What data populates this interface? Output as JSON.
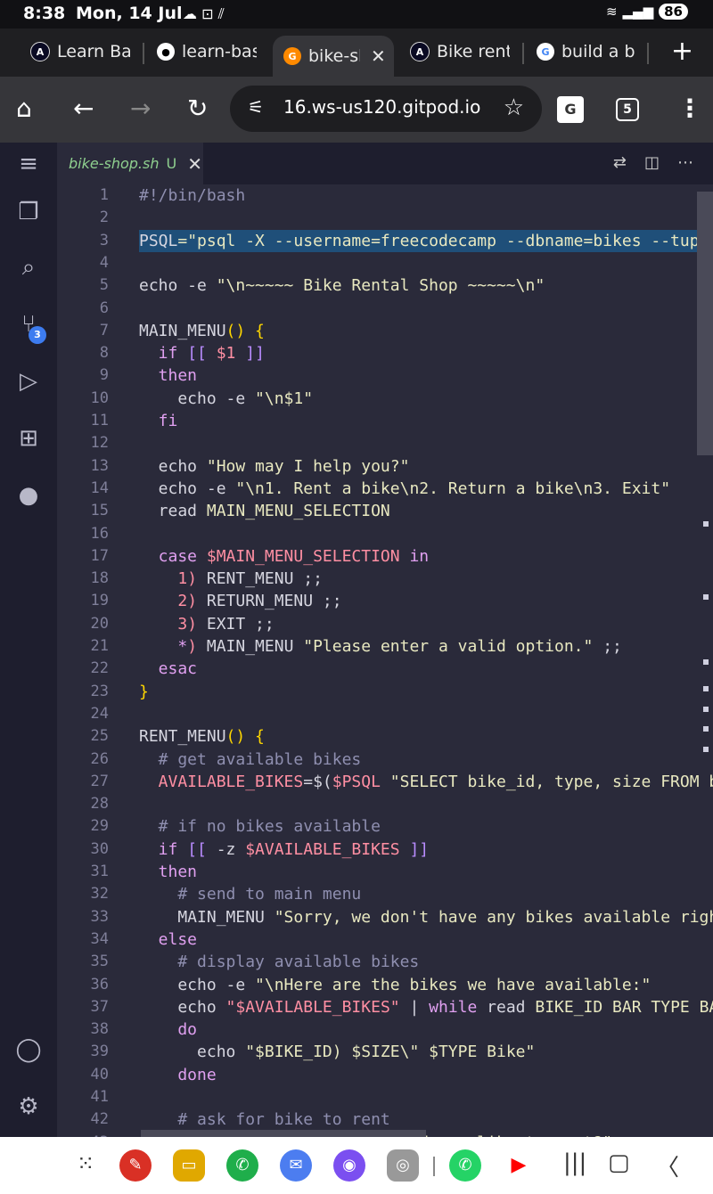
{
  "status_bar": {
    "time": "8:38",
    "date": "Mon, 14 Jul",
    "battery": "86"
  },
  "browser_tabs": [
    {
      "title": "Learn Bas",
      "favicon": "freecodecamp-icon"
    },
    {
      "title": "learn-bas",
      "favicon": "github-icon"
    },
    {
      "title": "bike-sh",
      "favicon": "gitpod-icon",
      "active": true
    },
    {
      "title": "Bike renta",
      "favicon": "freecodecamp-icon"
    },
    {
      "title": "build a bi",
      "favicon": "google-icon"
    }
  ],
  "toolbar": {
    "url": "16.ws-us120.gitpod.io",
    "tab_count": "5"
  },
  "editor_tab": {
    "filename": "bike-shop.sh",
    "status": "U"
  },
  "activity_badge": "3",
  "colors": {
    "keyword": "#e0a0f0",
    "variable": "#ff8fa3",
    "string": "#e8e8c0",
    "comment": "#8f8fb0",
    "brace": "#ffd700",
    "bracket": "#b98cff"
  },
  "code_lines": [
    {
      "n": "1",
      "segs": [
        {
          "t": "#!/bin/bash",
          "c": "comment"
        }
      ]
    },
    {
      "n": "2",
      "segs": []
    },
    {
      "n": "3",
      "segs": [
        {
          "t": "PSQL",
          "c": "plain"
        },
        {
          "t": "=\"psql -X --username=freecodecamp --dbname=bikes --tuples-only -c\"",
          "c": "string"
        }
      ],
      "highlight": true
    },
    {
      "n": "4",
      "segs": []
    },
    {
      "n": "5",
      "segs": [
        {
          "t": "echo -e ",
          "c": "plain"
        },
        {
          "t": "\"\\n~~~~~ Bike Rental Shop ~~~~~\\n\"",
          "c": "string"
        }
      ]
    },
    {
      "n": "6",
      "segs": []
    },
    {
      "n": "7",
      "segs": [
        {
          "t": "MAIN_MENU",
          "c": "plain"
        },
        {
          "t": "() {",
          "c": "brace"
        }
      ]
    },
    {
      "n": "8",
      "segs": [
        {
          "t": "  if ",
          "c": "keyword"
        },
        {
          "t": "[[ ",
          "c": "bracket"
        },
        {
          "t": "$1",
          "c": "variable"
        },
        {
          "t": " ]]",
          "c": "bracket"
        }
      ]
    },
    {
      "n": "9",
      "segs": [
        {
          "t": "  then",
          "c": "keyword"
        }
      ]
    },
    {
      "n": "10",
      "segs": [
        {
          "t": "    echo -e ",
          "c": "plain"
        },
        {
          "t": "\"\\n$1\"",
          "c": "string"
        }
      ]
    },
    {
      "n": "11",
      "segs": [
        {
          "t": "  fi",
          "c": "keyword"
        }
      ]
    },
    {
      "n": "12",
      "segs": []
    },
    {
      "n": "13",
      "segs": [
        {
          "t": "  echo ",
          "c": "plain"
        },
        {
          "t": "\"How may I help you?\"",
          "c": "string"
        }
      ]
    },
    {
      "n": "14",
      "segs": [
        {
          "t": "  echo -e ",
          "c": "plain"
        },
        {
          "t": "\"\\n1. Rent a bike\\n2. Return a bike\\n3. Exit\"",
          "c": "string"
        }
      ]
    },
    {
      "n": "15",
      "segs": [
        {
          "t": "  read ",
          "c": "plain"
        },
        {
          "t": "MAIN_MENU_SELECTION",
          "c": "string"
        }
      ]
    },
    {
      "n": "16",
      "segs": []
    },
    {
      "n": "17",
      "segs": [
        {
          "t": "  case ",
          "c": "keyword"
        },
        {
          "t": "$MAIN_MENU_SELECTION",
          "c": "variable"
        },
        {
          "t": " in",
          "c": "keyword"
        }
      ]
    },
    {
      "n": "18",
      "segs": [
        {
          "t": "    1",
          "c": "variable"
        },
        {
          "t": ") ",
          "c": "variable"
        },
        {
          "t": "RENT_MENU ;;",
          "c": "plain"
        }
      ]
    },
    {
      "n": "19",
      "segs": [
        {
          "t": "    2",
          "c": "variable"
        },
        {
          "t": ") ",
          "c": "variable"
        },
        {
          "t": "RETURN_MENU ;;",
          "c": "plain"
        }
      ]
    },
    {
      "n": "20",
      "segs": [
        {
          "t": "    3",
          "c": "variable"
        },
        {
          "t": ") ",
          "c": "variable"
        },
        {
          "t": "EXIT ;;",
          "c": "plain"
        }
      ]
    },
    {
      "n": "21",
      "segs": [
        {
          "t": "    *",
          "c": "keyword"
        },
        {
          "t": ") ",
          "c": "variable"
        },
        {
          "t": "MAIN_MENU ",
          "c": "plain"
        },
        {
          "t": "\"Please enter a valid option.\"",
          "c": "string"
        },
        {
          "t": " ;;",
          "c": "plain"
        }
      ]
    },
    {
      "n": "22",
      "segs": [
        {
          "t": "  esac",
          "c": "keyword"
        }
      ]
    },
    {
      "n": "23",
      "segs": [
        {
          "t": "}",
          "c": "brace"
        }
      ]
    },
    {
      "n": "24",
      "segs": []
    },
    {
      "n": "25",
      "segs": [
        {
          "t": "RENT_MENU",
          "c": "plain"
        },
        {
          "t": "() {",
          "c": "brace"
        }
      ]
    },
    {
      "n": "26",
      "segs": [
        {
          "t": "  # get available bikes",
          "c": "comment"
        }
      ]
    },
    {
      "n": "27",
      "segs": [
        {
          "t": "  AVAILABLE_BIKES",
          "c": "variable"
        },
        {
          "t": "=$(",
          "c": "plain"
        },
        {
          "t": "$PSQL",
          "c": "variable"
        },
        {
          "t": " \"SELECT bike_id, type, size FROM bikes WHERE available = true ORDER BY bike_id\")",
          "c": "string"
        }
      ]
    },
    {
      "n": "28",
      "segs": []
    },
    {
      "n": "29",
      "segs": [
        {
          "t": "  # if no bikes available",
          "c": "comment"
        }
      ]
    },
    {
      "n": "30",
      "segs": [
        {
          "t": "  if ",
          "c": "keyword"
        },
        {
          "t": "[[ ",
          "c": "bracket"
        },
        {
          "t": "-z ",
          "c": "plain"
        },
        {
          "t": "$AVAILABLE_BIKES",
          "c": "variable"
        },
        {
          "t": " ]]",
          "c": "bracket"
        }
      ]
    },
    {
      "n": "31",
      "segs": [
        {
          "t": "  then",
          "c": "keyword"
        }
      ]
    },
    {
      "n": "32",
      "segs": [
        {
          "t": "    # send to main menu",
          "c": "comment"
        }
      ]
    },
    {
      "n": "33",
      "segs": [
        {
          "t": "    MAIN_MENU ",
          "c": "plain"
        },
        {
          "t": "\"Sorry, we don't have any bikes available right now.\"",
          "c": "string"
        }
      ]
    },
    {
      "n": "34",
      "segs": [
        {
          "t": "  else",
          "c": "keyword"
        }
      ]
    },
    {
      "n": "35",
      "segs": [
        {
          "t": "    # display available bikes",
          "c": "comment"
        }
      ]
    },
    {
      "n": "36",
      "segs": [
        {
          "t": "    echo -e ",
          "c": "plain"
        },
        {
          "t": "\"\\nHere are the bikes we have available:\"",
          "c": "string"
        }
      ]
    },
    {
      "n": "37",
      "segs": [
        {
          "t": "    echo ",
          "c": "plain"
        },
        {
          "t": "\"$AVAILABLE_BIKES\"",
          "c": "variable"
        },
        {
          "t": " | ",
          "c": "plain"
        },
        {
          "t": "while ",
          "c": "keyword"
        },
        {
          "t": "read ",
          "c": "plain"
        },
        {
          "t": "BIKE_ID BAR TYPE BAR SIZE",
          "c": "string"
        }
      ]
    },
    {
      "n": "38",
      "segs": [
        {
          "t": "    do",
          "c": "keyword"
        }
      ]
    },
    {
      "n": "39",
      "segs": [
        {
          "t": "      echo ",
          "c": "plain"
        },
        {
          "t": "\"$BIKE_ID) $SIZE\\\" $TYPE Bike\"",
          "c": "string"
        }
      ]
    },
    {
      "n": "40",
      "segs": [
        {
          "t": "    done",
          "c": "keyword"
        }
      ]
    },
    {
      "n": "41",
      "segs": []
    },
    {
      "n": "42",
      "segs": [
        {
          "t": "    # ask for bike to rent",
          "c": "comment"
        }
      ]
    },
    {
      "n": "43",
      "segs": [
        {
          "t": "    echo -e ",
          "c": "plain"
        },
        {
          "t": "\"\\nWhich one would you like to rent?\"",
          "c": "string"
        }
      ]
    }
  ]
}
